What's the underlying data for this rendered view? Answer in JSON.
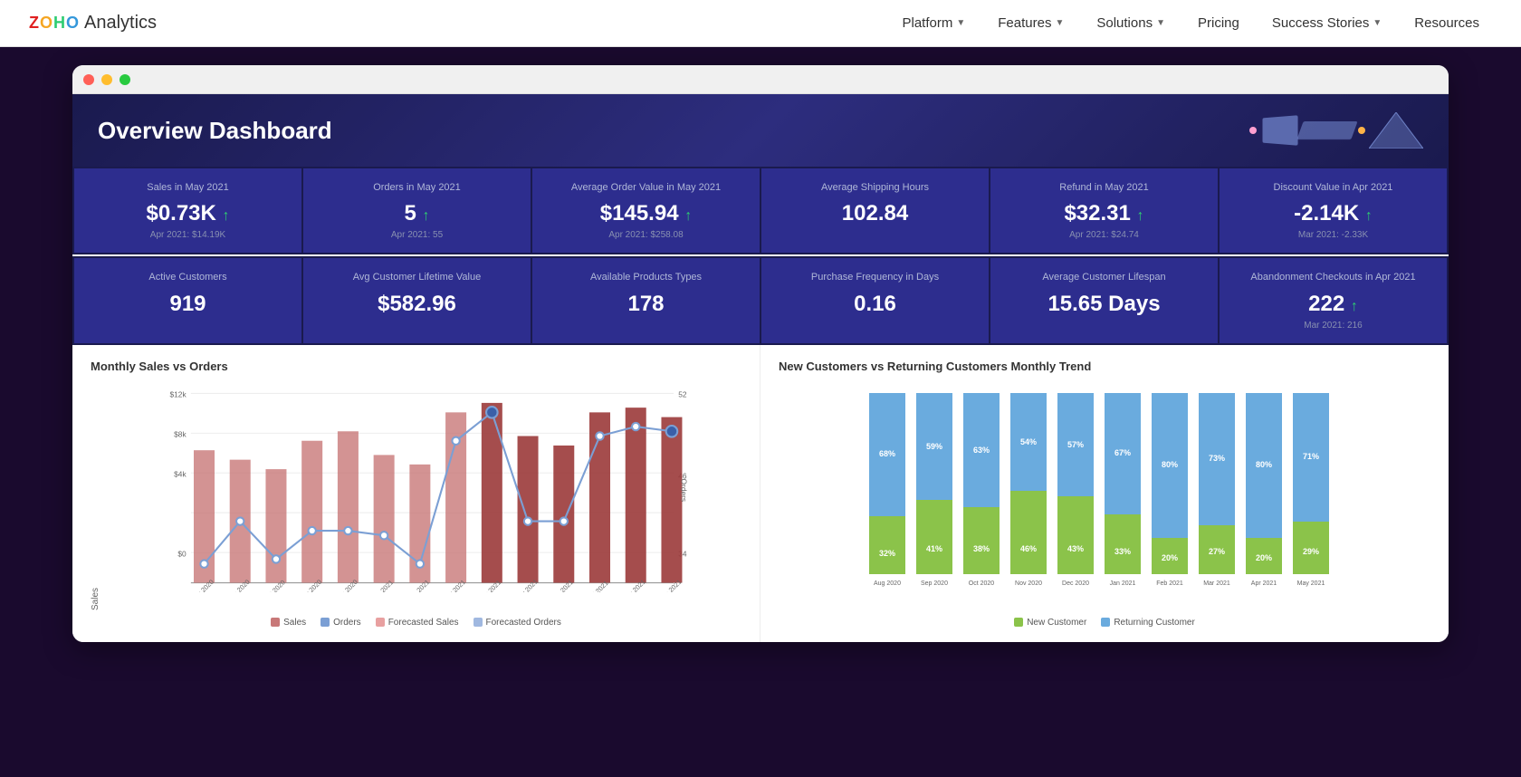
{
  "navbar": {
    "brand": "Analytics",
    "zoho": "ZOHO",
    "nav_items": [
      {
        "label": "Platform",
        "has_arrow": true
      },
      {
        "label": "Features",
        "has_arrow": true
      },
      {
        "label": "Solutions",
        "has_arrow": true
      },
      {
        "label": "Pricing",
        "has_arrow": false
      },
      {
        "label": "Success Stories",
        "has_arrow": true
      },
      {
        "label": "Resources",
        "has_arrow": false
      }
    ]
  },
  "dashboard": {
    "title": "Overview Dashboard",
    "kpi_row1": [
      {
        "label": "Sales in May 2021",
        "value": "$0.73K",
        "trend": "up",
        "sub": "Apr 2021: $14.19K"
      },
      {
        "label": "Orders in May 2021",
        "value": "5",
        "trend": "up",
        "sub": "Apr 2021: 55"
      },
      {
        "label": "Average Order Value in May 2021",
        "value": "$145.94",
        "trend": "up",
        "sub": "Apr 2021: $258.08"
      },
      {
        "label": "Average Shipping Hours",
        "value": "102.84",
        "trend": null,
        "sub": ""
      },
      {
        "label": "Refund in May 2021",
        "value": "$32.31",
        "trend": "up",
        "sub": "Apr 2021: $24.74"
      },
      {
        "label": "Discount Value in Apr 2021",
        "value": "-2.14K",
        "trend": "up",
        "sub": "Mar 2021: -2.33K"
      }
    ],
    "kpi_row2": [
      {
        "label": "Active Customers",
        "value": "919",
        "trend": null,
        "sub": ""
      },
      {
        "label": "Avg Customer Lifetime Value",
        "value": "$582.96",
        "trend": null,
        "sub": ""
      },
      {
        "label": "Available Products Types",
        "value": "178",
        "trend": null,
        "sub": ""
      },
      {
        "label": "Purchase Frequency in Days",
        "value": "0.16",
        "trend": null,
        "sub": ""
      },
      {
        "label": "Average Customer Lifespan",
        "value": "15.65 Days",
        "trend": null,
        "sub": ""
      },
      {
        "label": "Abandonment Checkouts in Apr 2021",
        "value": "222",
        "trend": "up",
        "sub": "Mar 2021: 216"
      }
    ],
    "charts": {
      "left": {
        "title": "Monthly Sales vs Orders",
        "y_label": "Sales",
        "y_right_label": "Orders",
        "x_labels": [
          "Aug 2020",
          "Sep 2020",
          "Oct 2020",
          "Nov 2020",
          "Dec 2020",
          "Jan 2021",
          "Feb 2021",
          "Mar 2021",
          "Apr 2021",
          "May 2021",
          "Jun 2021",
          "Jul 2021",
          "Aug 2021",
          "Sep 2021"
        ],
        "legend": [
          "Sales",
          "Orders",
          "Forecasted Sales",
          "Forecasted Orders"
        ]
      },
      "right": {
        "title": "New Customers vs Returning Customers Monthly Trend",
        "x_labels": [
          "Aug 2020",
          "Sep 2020",
          "Oct 2020",
          "Nov 2020",
          "Dec 2020",
          "Jan 2021",
          "Feb 2021",
          "Mar 2021",
          "Apr 2021",
          "May 2021"
        ],
        "new_pct": [
          32,
          41,
          38,
          46,
          43,
          33,
          20,
          27,
          20,
          29
        ],
        "returning_pct": [
          68,
          59,
          63,
          54,
          57,
          67,
          80,
          73,
          80,
          71
        ],
        "legend": [
          "New Customer",
          "Returning Customer"
        ]
      }
    }
  }
}
